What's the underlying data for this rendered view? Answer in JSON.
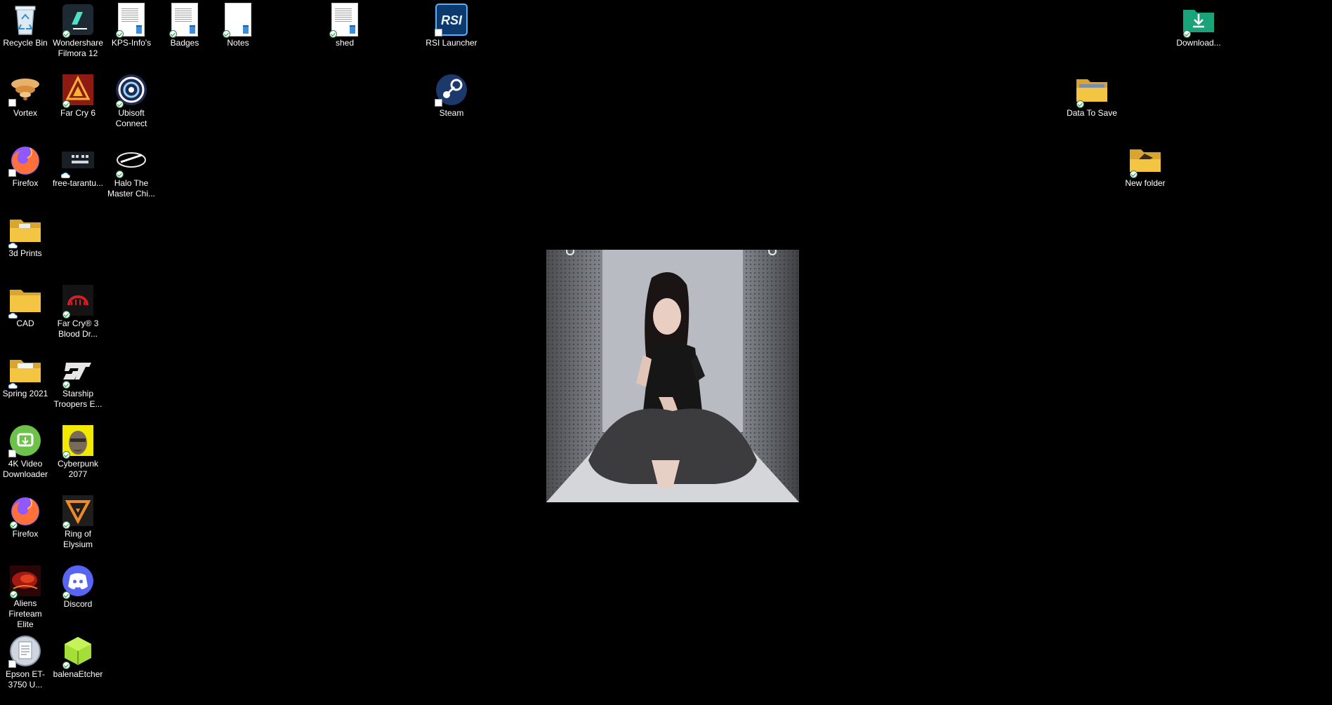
{
  "desktop": {
    "background_color": "#000000",
    "icons": {
      "recycle_bin": "Recycle Bin",
      "filmora": "Wondershare Filmora 12",
      "kps_info": "KPS-Info's",
      "badges": "Badges",
      "notes": "Notes",
      "shed": "shed",
      "rsi_launcher": "RSI Launcher",
      "downloads": "Download...",
      "vortex": "Vortex",
      "far_cry_6": "Far Cry 6",
      "ubisoft_connect": "Ubisoft Connect",
      "steam": "Steam",
      "data_to_save": "Data To Save",
      "firefox_1": "Firefox",
      "free_tarantula": "free-tarantu...",
      "halo": "Halo The Master Chi...",
      "new_folder": "New folder",
      "prints_3d": "3d Prints",
      "cad": "CAD",
      "far_cry_3": "Far Cry® 3 Blood Dr...",
      "spring_2021": "Spring 2021",
      "starship_troopers": "Starship Troopers E...",
      "video_downloader": "4K Video Downloader",
      "cyberpunk": "Cyberpunk 2077",
      "firefox_2": "Firefox",
      "ring_of_elysium": "Ring of Elysium",
      "aliens": "Aliens Fireteam Elite",
      "discord": "Discord",
      "epson": "Epson ET-3750 U...",
      "balena_etcher": "balenaEtcher"
    },
    "icon_kinds": {
      "recycle_bin": "recycle-bin-icon",
      "filmora": "filmora-icon",
      "kps_info": "text-document-icon",
      "badges": "text-document-icon",
      "notes": "text-document-icon",
      "shed": "text-document-icon",
      "rsi_launcher": "rsi-launcher-icon",
      "downloads": "downloads-folder-icon",
      "vortex": "vortex-icon",
      "far_cry_6": "far-cry-6-icon",
      "ubisoft_connect": "ubisoft-icon",
      "steam": "steam-icon",
      "data_to_save": "folder-icon",
      "firefox": "firefox-icon",
      "free_tarantula": "image-file-icon",
      "halo": "halo-icon",
      "new_folder": "folder-icon",
      "prints_3d": "folder-icon",
      "cad": "folder-icon",
      "far_cry_3": "far-cry-3-icon",
      "spring_2021": "folder-icon",
      "starship_troopers": "starship-troopers-icon",
      "video_downloader": "4k-video-downloader-icon",
      "cyberpunk": "cyberpunk-icon",
      "ring_of_elysium": "ring-of-elysium-icon",
      "aliens": "aliens-icon",
      "discord": "discord-icon",
      "epson": "epson-printer-icon",
      "balena_etcher": "balena-etcher-icon"
    },
    "colors": {
      "folder_yellow": "#f4c542",
      "sync_green": "#1b8f3b",
      "cloud_blue": "#4aa3f0",
      "discord": "#5865f2",
      "steam": "#1b3a6b",
      "download_teal": "#1aa37a"
    }
  }
}
